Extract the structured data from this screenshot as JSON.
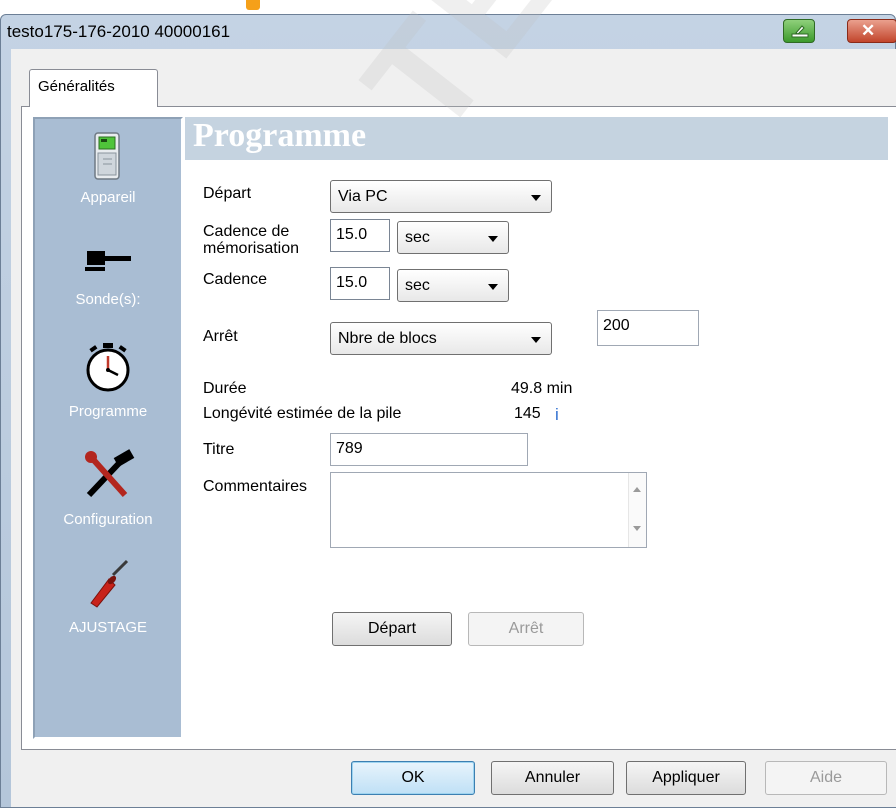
{
  "window": {
    "title": "testo175-176-2010 40000161"
  },
  "tabs": [
    {
      "label": "Généralités"
    }
  ],
  "sidebar": {
    "items": [
      {
        "label": "Appareil",
        "icon": "device-icon"
      },
      {
        "label": "Sonde(s):",
        "icon": "probe-icon"
      },
      {
        "label": "Programme",
        "icon": "stopwatch-icon"
      },
      {
        "label": "Configuration",
        "icon": "tools-icon"
      },
      {
        "label": "AJUSTAGE",
        "icon": "screwdriver-icon"
      }
    ]
  },
  "section": {
    "title": "Programme"
  },
  "form": {
    "depart_label": "Départ",
    "depart_value": "Via PC",
    "cadence_mem_label_1": "Cadence de",
    "cadence_mem_label_2": "mémorisation",
    "cadence_mem_value": "15.0",
    "cadence_mem_unit": "sec",
    "cadence_label": "Cadence",
    "cadence_value": "15.0",
    "cadence_unit": "sec",
    "arret_label": "Arrêt",
    "arret_mode": "Nbre de blocs",
    "arret_count": "200",
    "duree_label": "Durée",
    "duree_value": "49.8 min",
    "longevite_label": "Longévité estimée de la pile",
    "longevite_value": "145",
    "longevite_info": "i",
    "titre_label": "Titre",
    "titre_value": "789",
    "commentaires_label": "Commentaires",
    "commentaires_value": "",
    "start_button": "Départ",
    "stop_button": "Arrêt"
  },
  "footer": {
    "ok": "OK",
    "cancel": "Annuler",
    "apply": "Appliquer",
    "help": "Aide"
  },
  "watermark": "TESTO DEUTSCHER",
  "colors": {
    "sidebar_bg": "#a9bdd3",
    "header_bg": "#c5d3e0",
    "titlebar_bg": "#c4d3e4",
    "accent_orange": "#f5a019",
    "info_blue": "#2f6fd0"
  }
}
